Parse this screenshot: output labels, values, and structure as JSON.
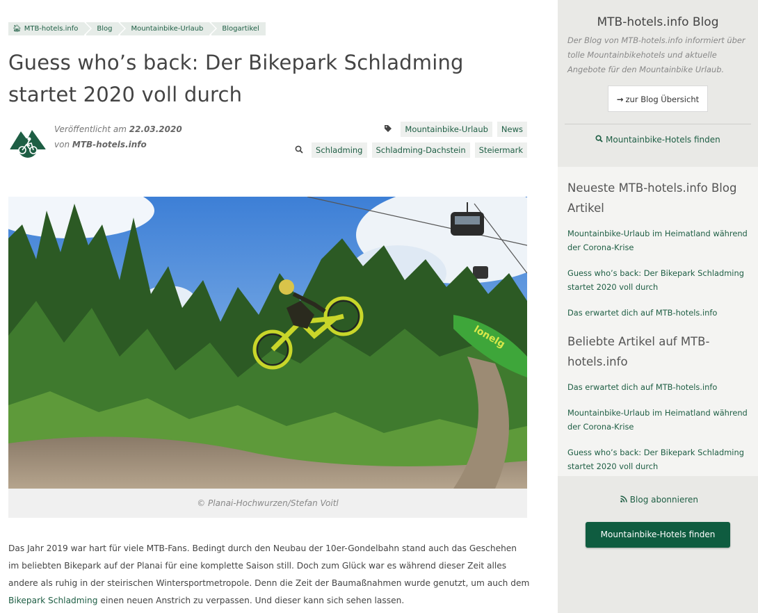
{
  "breadcrumb": {
    "home": "MTB-hotels.info",
    "blog": "Blog",
    "category": "Mountainbike-Urlaub",
    "current": "Blogartikel"
  },
  "article": {
    "title": "Guess who’s back: Der Bikepark Schladming startet 2020 voll durch",
    "published_prefix": "Veröffentlicht am",
    "published_date": "22.03.2020",
    "author_prefix": "von",
    "author": "MTB-hotels.info",
    "categories": [
      "Mountainbike-Urlaub",
      "News"
    ],
    "tags": [
      "Schladming",
      "Schladming-Dachstein",
      "Steiermark"
    ],
    "caption": "© Planai-Hochwurzen/Stefan Voitl",
    "body_before_link": "Das Jahr 2019 war hart für viele MTB-Fans. Bedingt durch den Neubau der 10er-Gondelbahn stand auch das Geschehen im beliebten Bikepark auf der Planai für eine komplette Saison still. Doch zum Glück war es während dieser Zeit alles andere als ruhig in der steirischen Wintersportmetropole. Denn die Zeit der Baumaßnahmen wurde genutzt, um auch dem ",
    "body_link": "Bikepark Schladming",
    "body_after_link": " einen neuen Anstrich zu verpassen. Und dieser kann sich sehen lassen."
  },
  "sidebar": {
    "title": "MTB-hotels.info Blog",
    "description": "Der Blog von MTB-hotels.info informiert über tolle Mountainbikehotels und aktuelle Angebote für den Mountainbike Urlaub.",
    "overview_button": "zur Blog Übersicht",
    "find_link": "Mountainbike-Hotels finden",
    "newest_heading": "Neueste MTB-hotels.info Blog Artikel",
    "newest": [
      "Mountainbike-Urlaub im Heimatland während der Corona-Krise",
      "Guess who’s back: Der Bikepark Schladming startet 2020 voll durch",
      "Das erwartet dich auf MTB-hotels.info"
    ],
    "popular_heading": "Beliebte Artikel auf MTB-hotels.info",
    "popular": [
      "Das erwartet dich auf MTB-hotels.info",
      "Mountainbike-Urlaub im Heimatland während der Corona-Krise",
      "Guess who’s back: Der Bikepark Schladming startet 2020 voll durch"
    ],
    "rss": "Blog abonnieren",
    "cta": "Mountainbike-Hotels finden"
  },
  "photo": {
    "banner_text": "lonelg"
  },
  "colors": {
    "brand_green": "#1e5e44",
    "cta_green": "#0f5c40",
    "sidebar_bg": "#e9e9e6"
  }
}
